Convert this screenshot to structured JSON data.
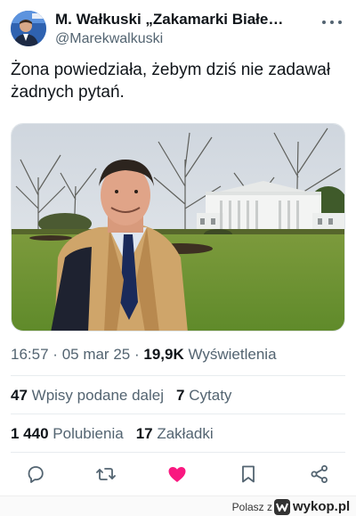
{
  "author": {
    "display_name": "M. Wałkuski „Zakamarki Białe…",
    "handle": "@Marekwalkuski",
    "avatar_icon": "avatar-photo"
  },
  "tweet": {
    "text": "Żona powiedziała, żebym dziś nie zadawał żadnych pytań.",
    "image_icon": "photo-white-house"
  },
  "meta": {
    "time": "16:57",
    "separator": "·",
    "date": "05 mar 25",
    "views_count": "19,9K",
    "views_label": "Wyświetlenia"
  },
  "stats": {
    "reposts_count": "47",
    "reposts_label": "Wpisy podane dalej",
    "quotes_count": "7",
    "quotes_label": "Cytaty",
    "likes_count": "1 440",
    "likes_label": "Polubienia",
    "bookmarks_count": "17",
    "bookmarks_label": "Zakładki"
  },
  "actions": {
    "icons": [
      "reply-icon",
      "repost-icon",
      "like-icon",
      "bookmark-icon",
      "share-icon"
    ],
    "like_color": "#f91880",
    "icon_color": "#536471"
  },
  "footer": {
    "label": "Polasz z",
    "brand": "wykop.pl"
  }
}
